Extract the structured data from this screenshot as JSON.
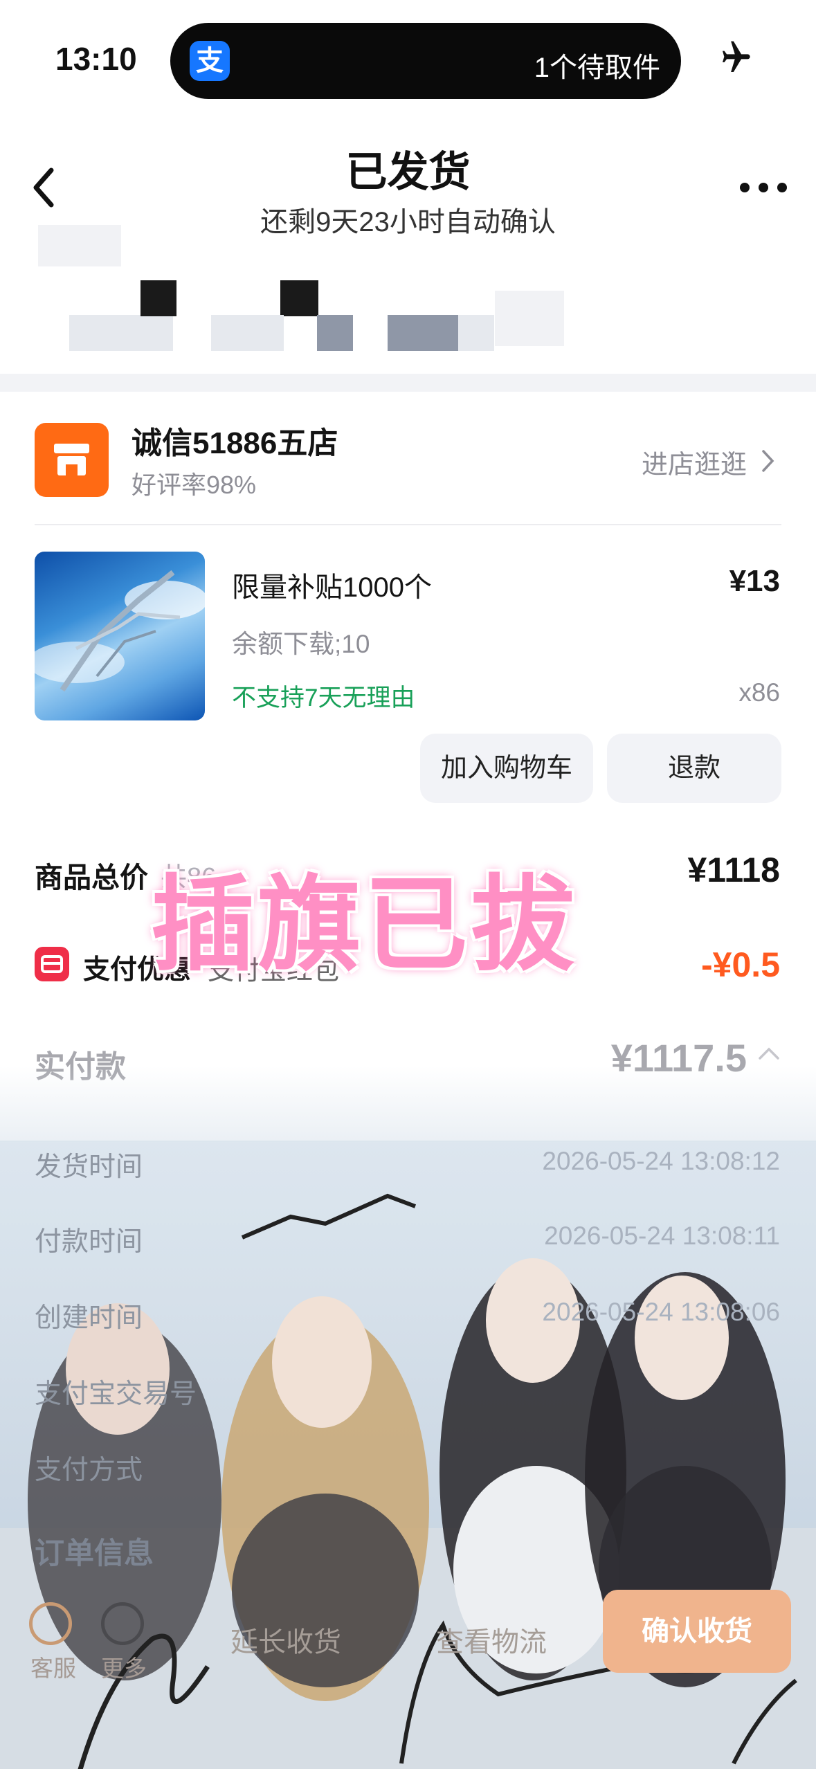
{
  "status_bar": {
    "time": "13:10",
    "island_app_glyph": "支",
    "island_text": "1个待取件",
    "right_icon": "airplane-icon"
  },
  "header": {
    "title": "已发货",
    "subtitle": "还剩9天23小时自动确认",
    "back_icon": "chevron-left-icon",
    "more_icon": "more-dots-icon"
  },
  "shop": {
    "name": "诚信51886五店",
    "rating": "好评率98%",
    "enter_label": "进店逛逛"
  },
  "product": {
    "name": "限量补贴1000个",
    "price": "¥13",
    "spec": "余额下载;10",
    "return_policy": "不支持7天无理由",
    "quantity": "x86",
    "add_to_cart_label": "加入购物车",
    "refund_label": "退款"
  },
  "summary": {
    "total_label": "商品总价",
    "total_sub": "共86",
    "total_value": "¥1118",
    "discount_label": "支付优惠",
    "discount_sub": "支付宝红包",
    "discount_value": "-¥0.5",
    "paid_label": "实付款",
    "paid_value": "¥1117.5"
  },
  "details": [
    {
      "label": "发货时间",
      "value": "2026-05-24 13:08:12"
    },
    {
      "label": "付款时间",
      "value": "2026-05-24 13:08:11"
    },
    {
      "label": "创建时间",
      "value": "2026-05-24 13:08:06"
    },
    {
      "label": "支付宝交易号",
      "value": ""
    },
    {
      "label": "支付方式",
      "value": ""
    }
  ],
  "order_info_label": "订单信息",
  "bottom_bar": {
    "service_label": "客服",
    "more_label": "更多",
    "extend_label": "延长收货",
    "logistics_label": "查看物流",
    "confirm_label": "确认收货"
  },
  "watermark": {
    "text": "插旗已拔"
  },
  "colors": {
    "accent_orange": "#ff6a14",
    "discount_red": "#ef2e48",
    "discount_value": "#ff5a1f",
    "green": "#18a058",
    "watermark_pink": "#ff8fc4"
  }
}
